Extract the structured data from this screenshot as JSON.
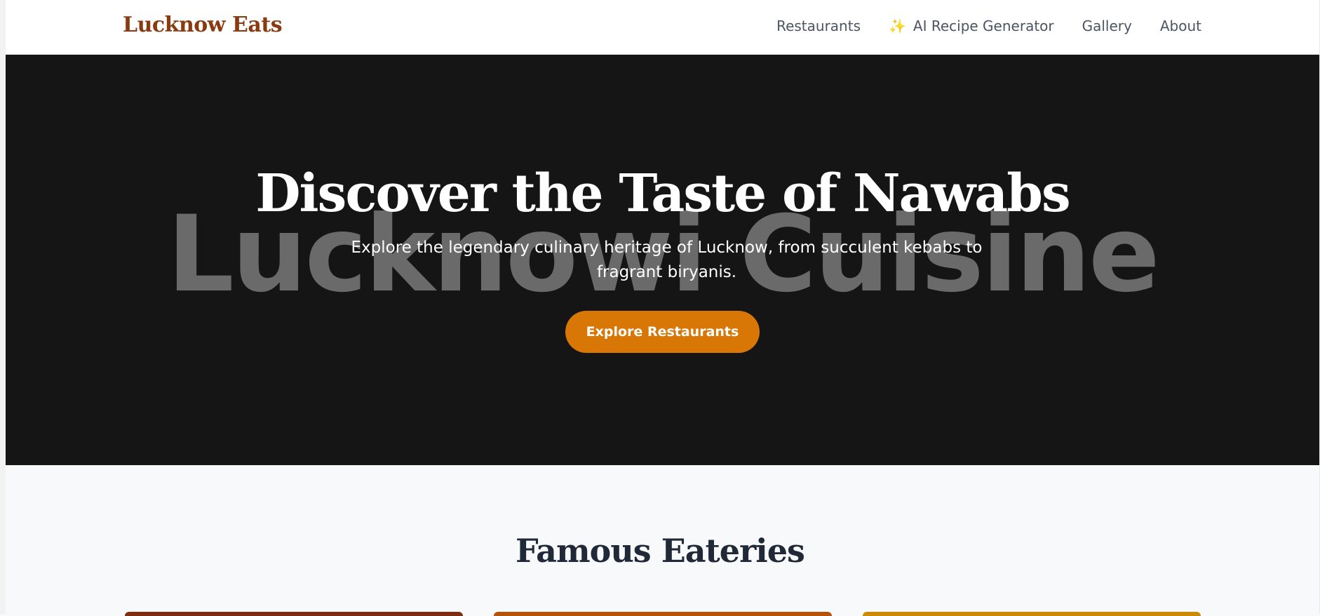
{
  "nav": {
    "brand": "Lucknow Eats",
    "links": [
      {
        "label": "Restaurants"
      },
      {
        "label": "AI Recipe Generator",
        "icon": "sparkles-icon"
      },
      {
        "label": "Gallery"
      },
      {
        "label": "About"
      }
    ]
  },
  "hero": {
    "watermark": "Lucknowi Cuisine",
    "title": "Discover the Taste of Nawabs",
    "subtitle": "Explore the legendary culinary heritage of Lucknow, from succulent kebabs to fragrant biryanis.",
    "button_label": "Explore Restaurants"
  },
  "section": {
    "title": "Famous Eateries"
  },
  "colors": {
    "brand": "#8b3a0f",
    "accent": "#d97706",
    "hero_bg": "#151515"
  }
}
